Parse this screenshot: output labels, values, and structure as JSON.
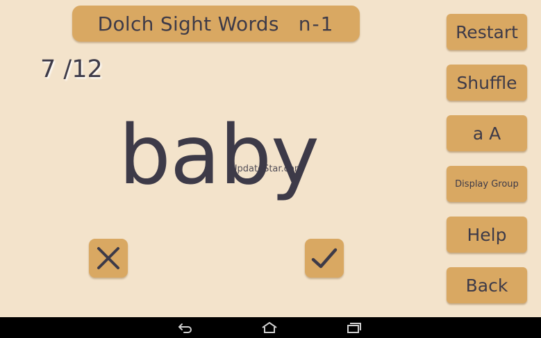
{
  "header": {
    "title": "Dolch Sight Words",
    "list_code": "n-1"
  },
  "progress": {
    "current": "7",
    "separator": " /",
    "total": "12"
  },
  "card": {
    "word": "baby",
    "watermark": "UpdateStar.com"
  },
  "answer": {
    "wrong_icon": "x-icon",
    "right_icon": "check-icon"
  },
  "sidebar": {
    "restart": "Restart",
    "shuffle": "Shuffle",
    "case_toggle": "a A",
    "display_group": "Display Group",
    "help": "Help",
    "back": "Back"
  },
  "colors": {
    "background": "#f3e3cb",
    "button": "#d9a862",
    "text": "#3d3a48",
    "nav": "#000000"
  },
  "system_nav": {
    "back_icon": "back-icon",
    "home_icon": "home-icon",
    "recents_icon": "recents-icon"
  }
}
